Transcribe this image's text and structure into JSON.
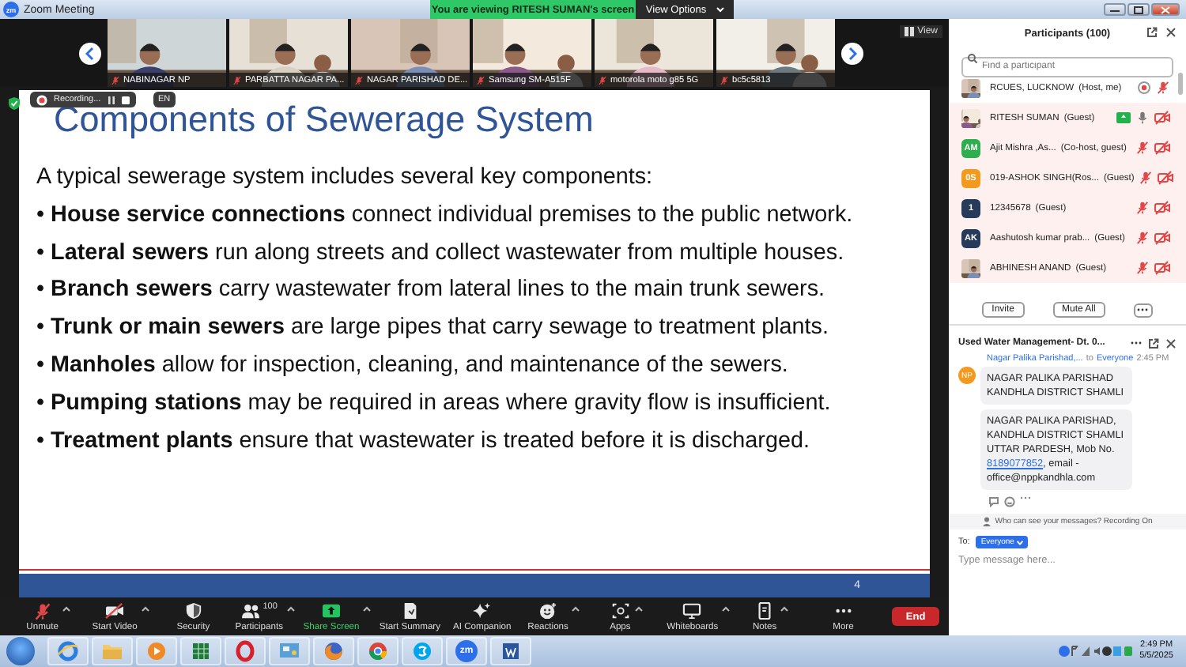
{
  "window": {
    "logo": "zm",
    "title": "Zoom Meeting"
  },
  "banner": {
    "text": "You are viewing RITESH SUMAN's screen",
    "view_options": "View Options"
  },
  "video_strip": {
    "view_button": "View",
    "tiles": [
      {
        "name": "NABINAGAR NP",
        "muted": true
      },
      {
        "name": "PARBATTA NAGAR PA...",
        "muted": true
      },
      {
        "name": "NAGAR PARISHAD DE...",
        "muted": true
      },
      {
        "name": "Samsung SM-A515F",
        "muted": true
      },
      {
        "name": "motorola moto g85 5G",
        "muted": true
      },
      {
        "name": "bc5c5813",
        "muted": true
      }
    ]
  },
  "recording": {
    "label": "Recording...",
    "language": "EN"
  },
  "slide": {
    "title": "Components of Sewerage System",
    "intro": "A typical sewerage system includes several key components:",
    "bullets": [
      "• **House service connections** connect individual premises to the public network.",
      "• **Lateral sewers** run along streets and collect wastewater from multiple houses.",
      "• **Branch sewers** carry wastewater from lateral lines to the main trunk sewers.",
      "• **Trunk or main sewers** are large pipes that carry sewage to treatment plants.",
      "• **Manholes** allow for inspection, cleaning, and maintenance of the sewers.",
      "• **Pumping stations** may be required in areas where gravity flow is insufficient.",
      "• **Treatment plants** ensure that wastewater is treated before it is discharged."
    ],
    "page": "4"
  },
  "participants": {
    "title": "Participants (100)",
    "search": {
      "placeholder": "Find a participant"
    },
    "rows": [
      {
        "name": "RCUES, LUCKNOW",
        "role": "(Host, me)",
        "badge": {
          "kind": "recording"
        },
        "muted": true,
        "video_off": false,
        "highlighted": false
      },
      {
        "name": "RITESH SUMAN",
        "role": "(Guest)",
        "badge": {
          "kind": "sharing"
        },
        "muted": false,
        "video_off": true,
        "highlighted": true
      },
      {
        "avatar": {
          "kind": "initials",
          "text": "AM",
          "color": "#2fae4e"
        },
        "name": "Ajit Mishra ,As...",
        "role": "(Co-host, guest)",
        "muted": true,
        "video_off": true,
        "highlighted": true
      },
      {
        "avatar": {
          "kind": "initials",
          "text": "0S",
          "color": "#f39a1e"
        },
        "name": "019-ASHOK SINGH(Ros...",
        "role": "(Guest)",
        "muted": true,
        "video_off": true,
        "highlighted": true
      },
      {
        "avatar": {
          "kind": "initials",
          "text": "1",
          "color": "#263a5a"
        },
        "name": "12345678",
        "role": "(Guest)",
        "muted": true,
        "video_off": true,
        "highlighted": true
      },
      {
        "avatar": {
          "kind": "initials",
          "text": "AK",
          "color": "#263a5a"
        },
        "name": "Aashutosh kumar prab...",
        "role": "(Guest)",
        "muted": true,
        "video_off": true,
        "highlighted": true
      },
      {
        "name": "ABHINESH ANAND",
        "role": "(Guest)",
        "muted": true,
        "video_off": true,
        "highlighted": true
      }
    ],
    "buttons": [
      "Invite",
      "Mute All"
    ]
  },
  "chat": {
    "title": "Used Water Management- Dt. 0...",
    "sender": "Nagar Palika Parishad,...",
    "to": "to",
    "recipient": "Everyone",
    "time": "2:45 PM",
    "avatar": "NP",
    "messages": [
      {
        "text": "NAGAR PALIKA PARISHAD KANDHLA DISTRICT SHAMLI"
      },
      {
        "text": "NAGAR PALIKA PARISHAD, KANDHLA DISTRICT SHAMLI UTTAR PARDESH, Mob No.",
        "link": "8189077852",
        "text_after": ", email - office@nppkandhla.com"
      }
    ],
    "privacy_note": "Who can see your messages? Recording On",
    "to_label": "To:",
    "to_button": "Everyone",
    "input": {
      "placeholder": "Type message here..."
    }
  },
  "toolbar": {
    "items": [
      {
        "kind": "mic",
        "label": "Unmute",
        "off": true,
        "caret": true
      },
      {
        "kind": "video",
        "label": "Start Video",
        "off": true,
        "caret": true
      },
      {
        "kind": "security",
        "label": "Security",
        "caret": false
      },
      {
        "kind": "participants",
        "label": "Participants",
        "count": "100",
        "caret": true
      },
      {
        "kind": "share",
        "label": "Share Screen",
        "caret": true
      },
      {
        "kind": "summary",
        "label": "Start Summary",
        "caret": false
      },
      {
        "kind": "ai",
        "label": "AI Companion",
        "caret": false
      },
      {
        "kind": "reactions",
        "label": "Reactions",
        "caret": true
      },
      {
        "kind": "apps",
        "label": "Apps",
        "caret": true
      },
      {
        "kind": "whiteboards",
        "label": "Whiteboards",
        "caret": true
      },
      {
        "kind": "notes",
        "label": "Notes",
        "caret": true
      },
      {
        "kind": "more",
        "label": "More",
        "caret": false
      }
    ],
    "end": "End"
  },
  "taskbar": {
    "zoom_logo": "zm",
    "time": "2:49 PM",
    "date": "5/5/2025"
  }
}
